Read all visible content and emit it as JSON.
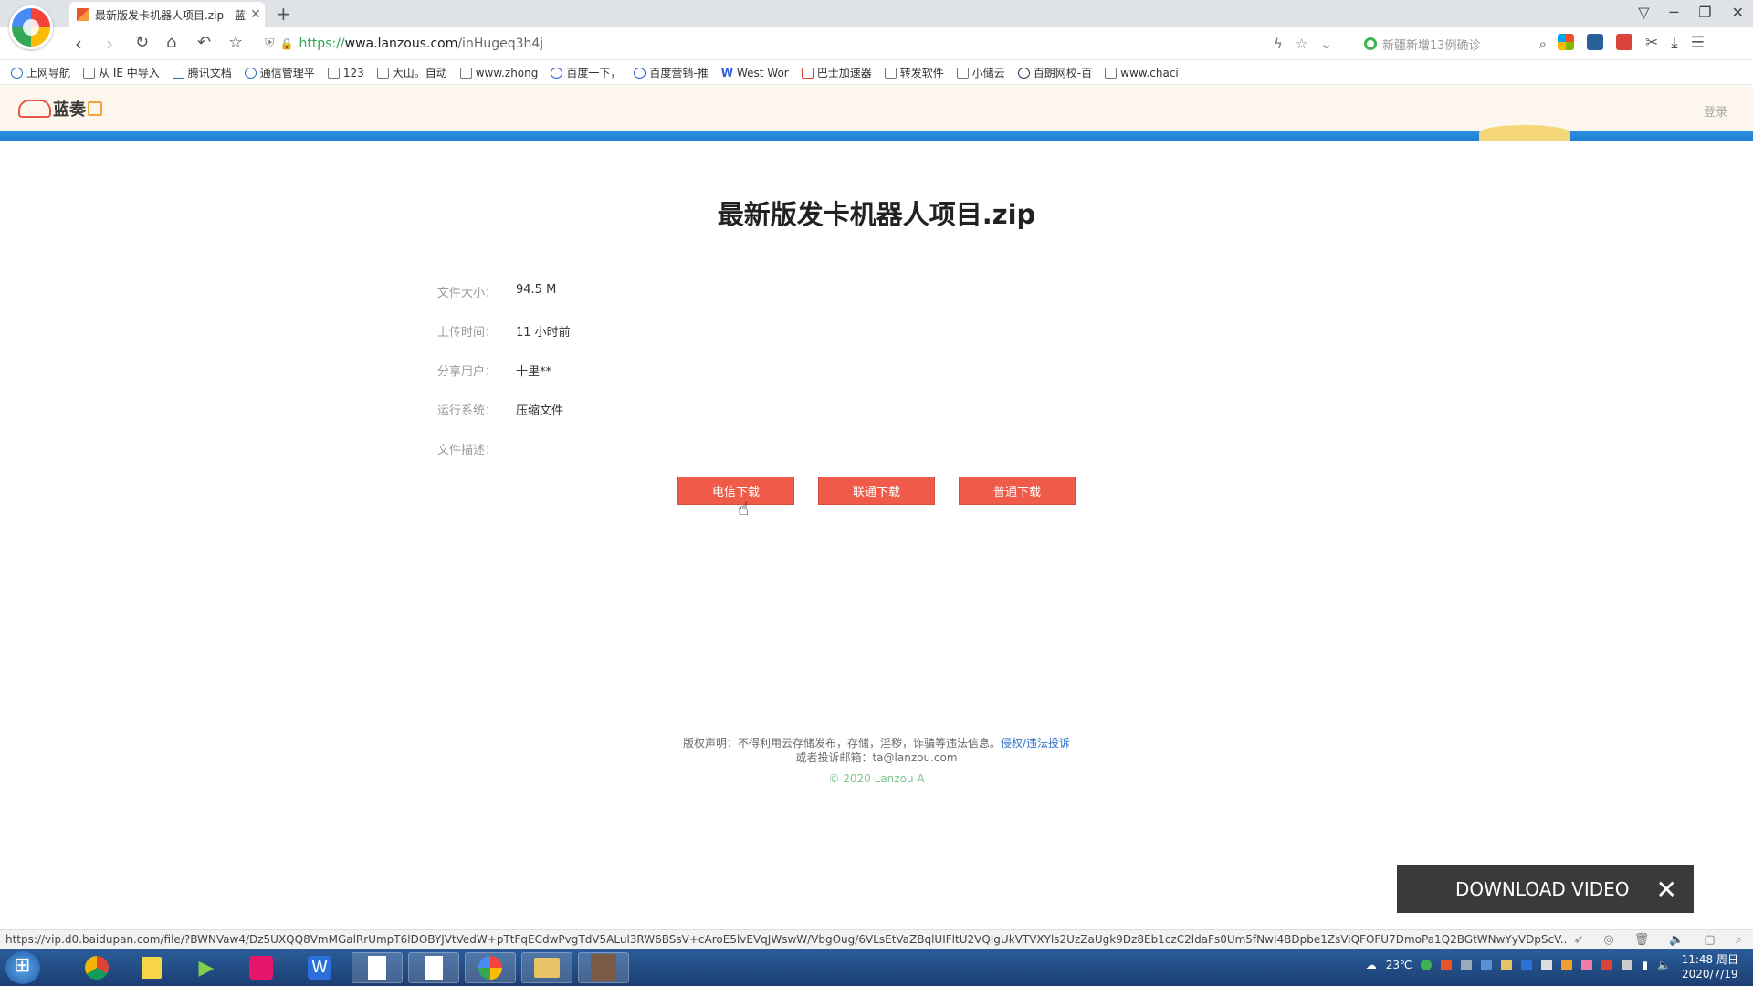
{
  "browser": {
    "tab_title": "最新版发卡机器人项目.zip - 蓝",
    "url_scheme": "https://",
    "url_host": "wwa.lanzous.com",
    "url_path": "/inHugeq3h4j",
    "search_placeholder": "新疆新增13例确诊",
    "bookmarks": [
      "上网导航",
      "从 IE 中导入",
      "腾讯文档",
      "通信管理平",
      "123",
      "大山。自动",
      "www.zhong",
      "百度一下，",
      "百度营销-推",
      "West Wor",
      "巴士加速器",
      "转发软件",
      "小储云",
      "百朗网校-百",
      "www.chaci"
    ]
  },
  "site": {
    "logo_text": "蓝奏",
    "login": "登录"
  },
  "file": {
    "title": "最新版发卡机器人项目.zip",
    "size_label": "文件大小：",
    "size": "94.5 M",
    "time_label": "上传时间：",
    "time": "11 小时前",
    "user_label": "分享用户：",
    "user": "十里**",
    "system_label": "运行系统：",
    "system": "压缩文件",
    "desc_label": "文件描述：",
    "desc": ""
  },
  "buttons": {
    "telecom": "电信下载",
    "unicom": "联通下载",
    "normal": "普通下载"
  },
  "footer": {
    "notice": "版权声明：不得利用云存储发布，存储，淫秽，诈骗等违法信息。",
    "report_link": "侵权/违法投诉",
    "email_line": "或者投诉邮箱：ta@lanzou.com",
    "copyright": "© 2020 Lanzou A"
  },
  "download_video": "DOWNLOAD VIDEO",
  "status_url": "https://vip.d0.baidupan.com/file/?BWNVaw4/Dz5UXQQ8VmMGalRrUmpT6lDOBYJVtVedW+pTtFqECdwPvgTdV5ALul3RW6BSsV+cAroE5lvEVqJWswW/VbgOug/6VLsEtVaZBqlUIFltU2VQIgUkVTVXYls2UzZaUgk9Dz8Eb1czC2ldaFs0Um5fNwI4BDpbe1ZsViQFOFU7DmoPa1Q2BGtWNwYyVDpScV...",
  "taskbar": {
    "weather": "23℃",
    "time": "11:48 周日",
    "date": "2020/7/19"
  }
}
